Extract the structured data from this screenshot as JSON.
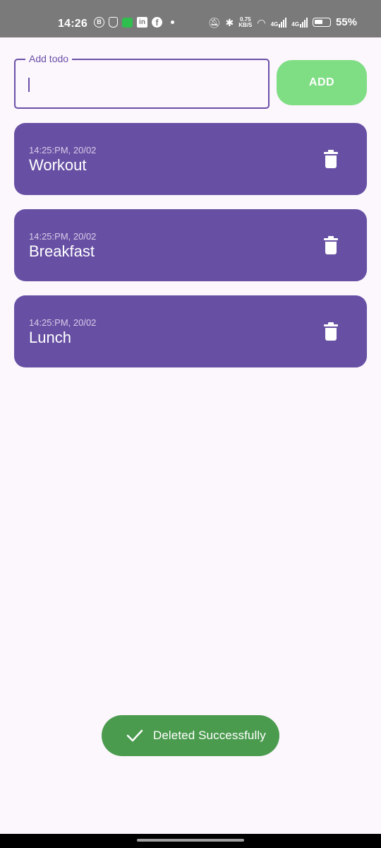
{
  "status_bar": {
    "time": "14:26",
    "net_speed": "0.75",
    "net_unit": "KB/S",
    "net_label_1": "4G",
    "net_label_2": "4G",
    "battery": "55%"
  },
  "input": {
    "label": "Add todo",
    "value": ""
  },
  "add_button": {
    "label": "ADD",
    "color": "#7fdd84"
  },
  "todos": [
    {
      "time": "14:25:PM, 20/02",
      "title": "Workout"
    },
    {
      "time": "14:25:PM, 20/02",
      "title": "Breakfast"
    },
    {
      "time": "14:25:PM, 20/02",
      "title": "Lunch"
    }
  ],
  "toast": {
    "text": "Deleted Successfully",
    "icon": "check-icon",
    "color": "#4b9b4f"
  },
  "colors": {
    "primary": "#6750a4",
    "background": "#fcf6fd"
  }
}
